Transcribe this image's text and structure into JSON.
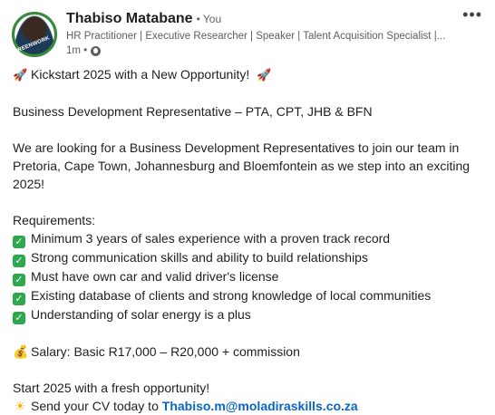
{
  "author": {
    "name": "Thabiso Matabane",
    "you_badge": "• You",
    "headline": "HR Practitioner | Executive Researcher | Speaker | Talent Acquisition Specialist |...",
    "time": "1m •",
    "avatar_badge": "GREENWORK"
  },
  "post": {
    "title_line": "Kickstart 2025 with a New Opportunity!",
    "role_line": "Business Development Representative – PTA, CPT, JHB & BFN",
    "intro": "We are looking for a Business Development Representatives to join our team in Pretoria, Cape Town, Johannesburg and Bloemfontein as we step into an exciting 2025!",
    "requirements_heading": "Requirements:",
    "requirements": [
      "Minimum 3 years of sales experience with a proven track record",
      "Strong communication skills and ability to build relationships",
      "Must have own car and valid driver's license",
      "Existing database of clients and strong knowledge of local communities",
      "Understanding of solar energy is a plus"
    ],
    "salary": "Salary: Basic R17,000 – R20,000 + commission",
    "closing": "Start 2025 with a fresh opportunity!",
    "cta_prefix": "Send your CV today to",
    "email": "Thabiso.m@moladiraskills.co.za"
  },
  "icons": {
    "rocket": "rocket-icon",
    "check": "check-mark-icon",
    "money": "money-bag-icon",
    "sun": "sun-icon",
    "globe": "globe-icon",
    "more": "more-options-icon"
  },
  "colors": {
    "link": "#0a66c2",
    "check": "#2ea84f",
    "avatar_ring": "#3a8a3d"
  }
}
